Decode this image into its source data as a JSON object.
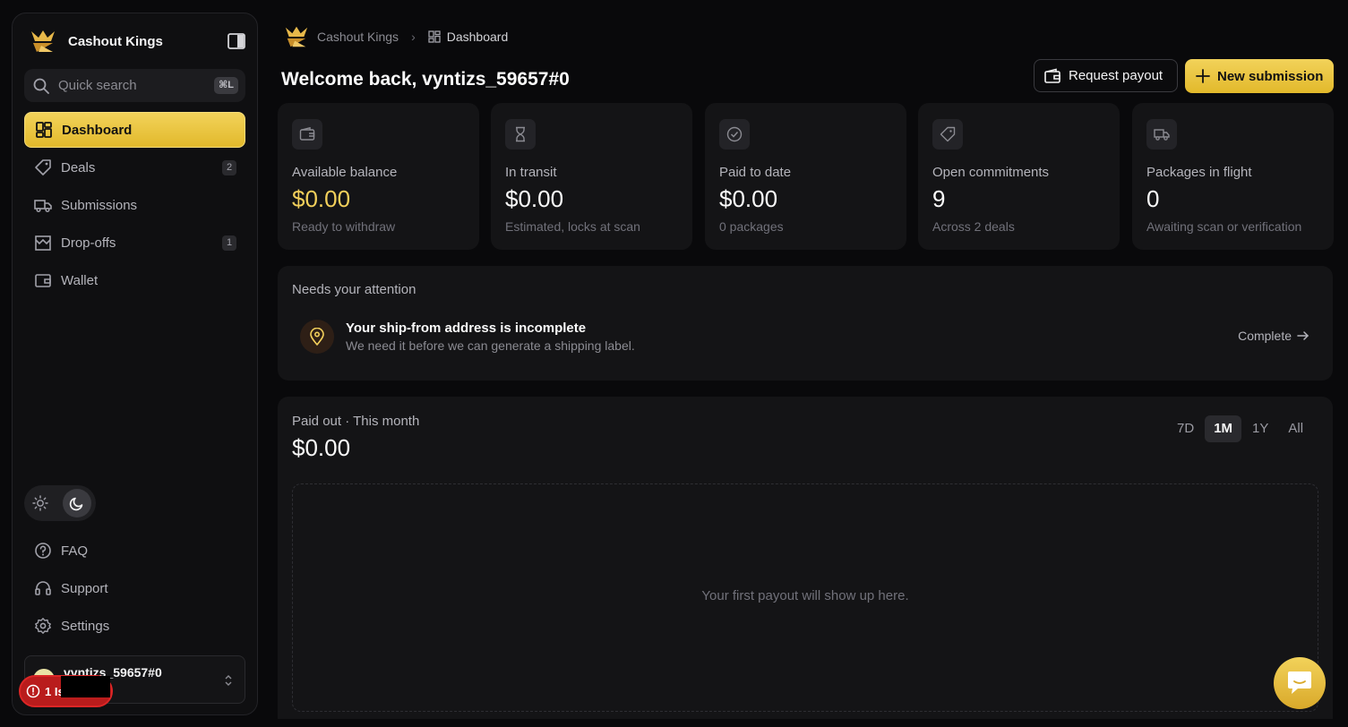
{
  "brand": {
    "name": "Cashout Kings"
  },
  "search": {
    "placeholder": "Quick search",
    "shortcut": "⌘L"
  },
  "nav": {
    "items": [
      {
        "label": "Dashboard",
        "active": true
      },
      {
        "label": "Deals",
        "badge": "2"
      },
      {
        "label": "Submissions"
      },
      {
        "label": "Drop-offs",
        "badge": "1"
      },
      {
        "label": "Wallet"
      }
    ],
    "bottom": [
      {
        "label": "FAQ"
      },
      {
        "label": "Support"
      },
      {
        "label": "Settings"
      }
    ]
  },
  "user": {
    "name": "vyntizs_59657#0"
  },
  "issues": {
    "label": "1 Is"
  },
  "breadcrumb": {
    "root": "Cashout Kings",
    "current": "Dashboard"
  },
  "header": {
    "welcome": "Welcome back, vyntizs_59657#0",
    "request_payout": "Request payout",
    "new_submission": "New submission"
  },
  "stats": [
    {
      "label": "Available balance",
      "value": "$0.00",
      "sub": "Ready to withdraw"
    },
    {
      "label": "In transit",
      "value": "$0.00",
      "sub": "Estimated, locks at scan"
    },
    {
      "label": "Paid to date",
      "value": "$0.00",
      "sub": "0 packages"
    },
    {
      "label": "Open commitments",
      "value": "9",
      "sub": "Across 2 deals"
    },
    {
      "label": "Packages in flight",
      "value": "0",
      "sub": "Awaiting scan or verification"
    }
  ],
  "attention": {
    "title": "Needs your attention",
    "heading": "Your ship-from address is incomplete",
    "description": "We need it before we can generate a shipping label.",
    "action": "Complete"
  },
  "paid_out": {
    "title": "Paid out · This month",
    "value": "$0.00",
    "ranges": [
      "7D",
      "1M",
      "1Y",
      "All"
    ],
    "selected_range": "1M",
    "empty_text": "Your first payout will show up here."
  },
  "colors": {
    "accent": "#f2cf5b",
    "background": "#09090b",
    "card": "#141416",
    "danger": "#b91c1c"
  }
}
